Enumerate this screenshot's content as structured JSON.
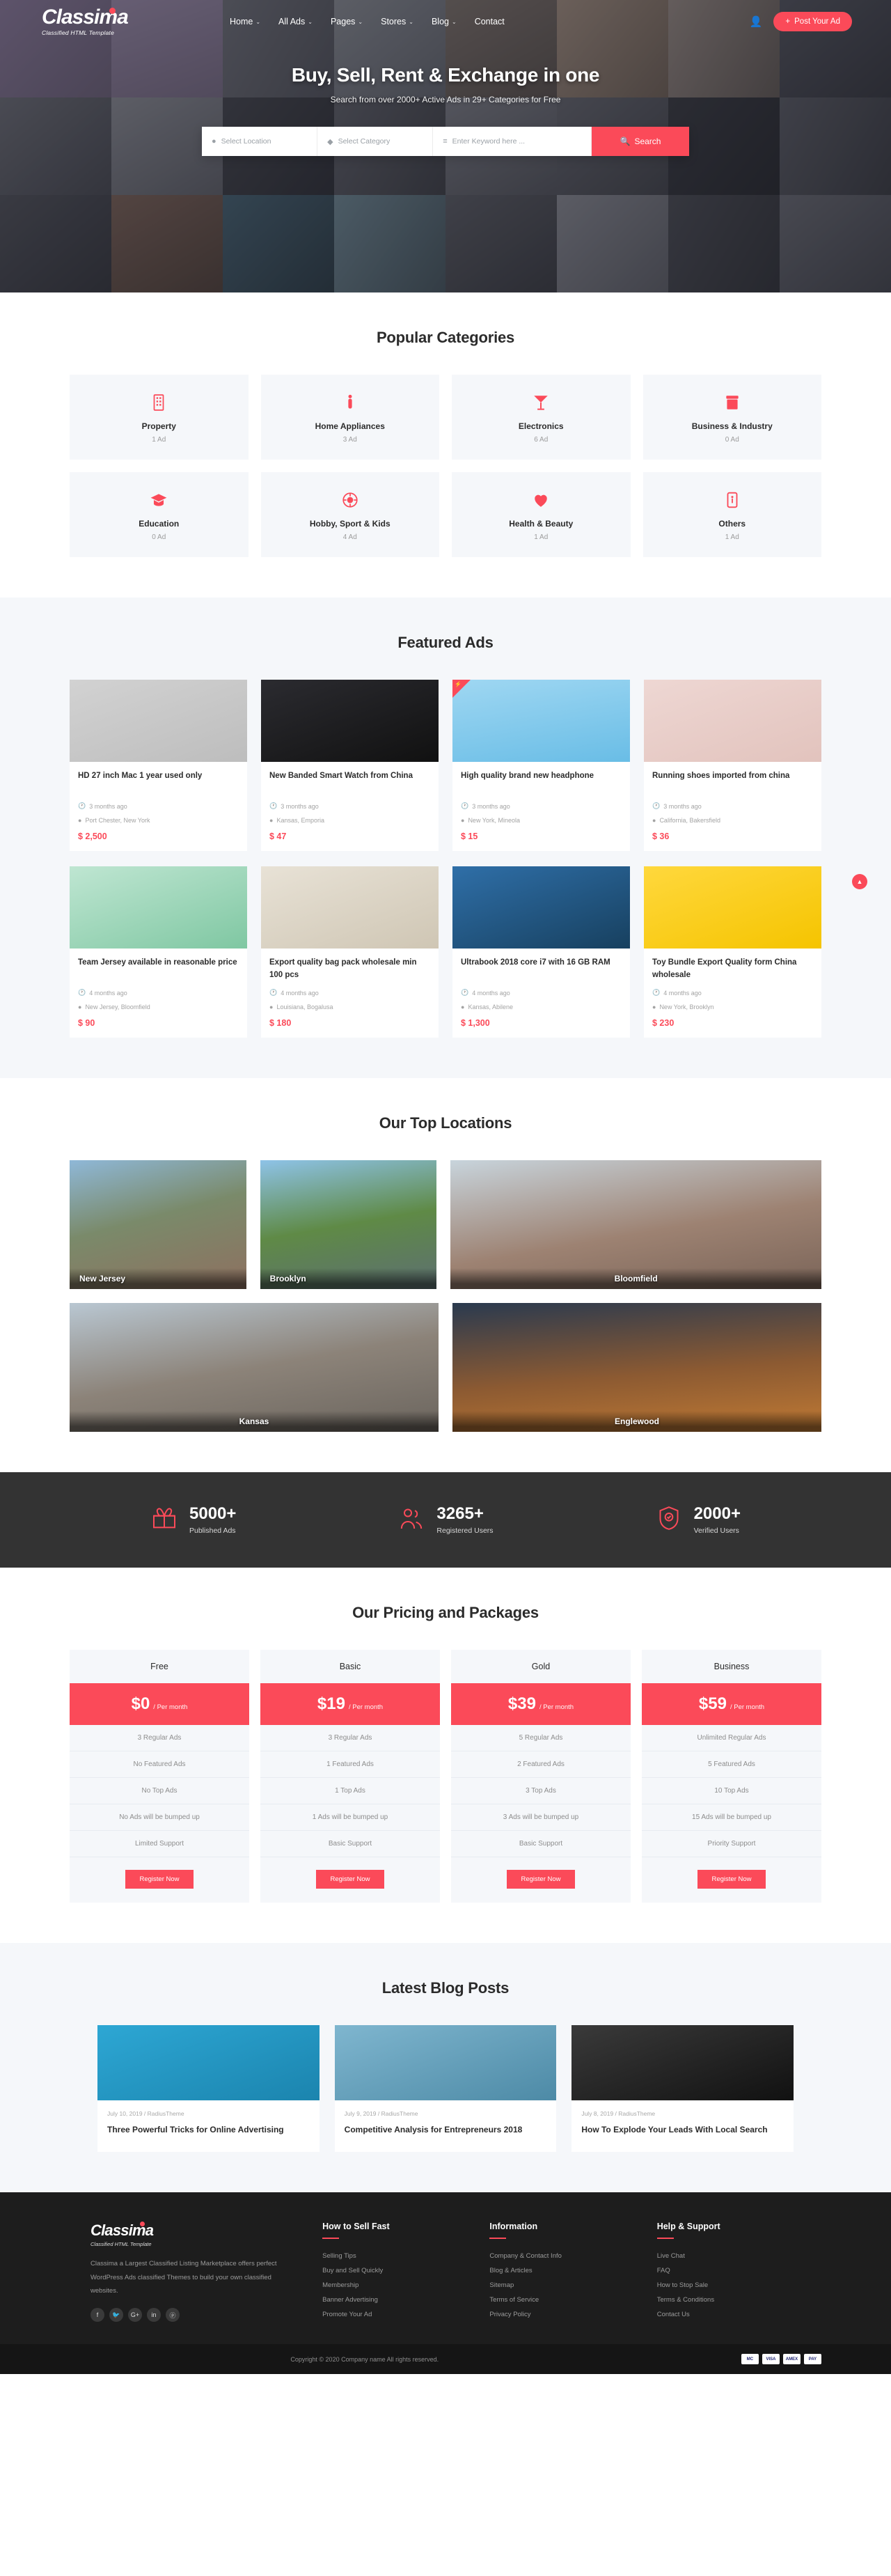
{
  "brand": {
    "name": "Classima",
    "tagline": "Classified HTML Template"
  },
  "nav": {
    "items": [
      {
        "label": "Home",
        "caret": "⌄"
      },
      {
        "label": "All Ads",
        "caret": "⌄"
      },
      {
        "label": "Pages",
        "caret": "⌄"
      },
      {
        "label": "Stores",
        "caret": "⌄"
      },
      {
        "label": "Blog",
        "caret": "⌄"
      },
      {
        "label": "Contact",
        "caret": ""
      }
    ],
    "user_icon": "user-icon",
    "post_ad_label": "Post Your Ad",
    "post_ad_plus": "+"
  },
  "hero": {
    "title": "Buy, Sell, Rent & Exchange in one",
    "subtitle": "Search from over 2000+ Active Ads in 29+ Categories for Free",
    "search": {
      "location_placeholder": "Select Location",
      "category_placeholder": "Select Category",
      "keyword_placeholder": "Enter Keyword here ...",
      "button_label": "Search"
    }
  },
  "categories": {
    "title": "Popular Categories",
    "items": [
      {
        "name": "Property",
        "count": "1 Ad",
        "icon": "building-icon"
      },
      {
        "name": "Home Appliances",
        "count": "3 Ad",
        "icon": "person-icon"
      },
      {
        "name": "Electronics",
        "count": "6 Ad",
        "icon": "cocktail-icon"
      },
      {
        "name": "Business & Industry",
        "count": "0 Ad",
        "icon": "briefcase-icon"
      },
      {
        "name": "Education",
        "count": "0 Ad",
        "icon": "graduation-cap-icon"
      },
      {
        "name": "Hobby, Sport & Kids",
        "count": "4 Ad",
        "icon": "ball-icon"
      },
      {
        "name": "Health & Beauty",
        "count": "1 Ad",
        "icon": "heart-icon"
      },
      {
        "name": "Others",
        "count": "1 Ad",
        "icon": "tag-icon"
      }
    ]
  },
  "featured": {
    "title": "Featured Ads",
    "ads": [
      {
        "title": "HD 27 inch Mac 1 year used only",
        "time": "3 months ago",
        "location": "Port Chester, New York",
        "price": "$ 2,500",
        "badge": ""
      },
      {
        "title": "New Banded Smart Watch from China",
        "time": "3 months ago",
        "location": "Kansas, Emporia",
        "price": "$ 47",
        "badge": ""
      },
      {
        "title": "High quality brand new headphone",
        "time": "3 months ago",
        "location": "New York, Mineola",
        "price": "$ 15",
        "badge": "⚡"
      },
      {
        "title": "Running shoes imported from china",
        "time": "3 months ago",
        "location": "California, Bakersfield",
        "price": "$ 36",
        "badge": ""
      },
      {
        "title": "Team Jersey available in reasonable price",
        "time": "4 months ago",
        "location": "New Jersey, Bloomfield",
        "price": "$ 90",
        "badge": ""
      },
      {
        "title": "Export quality bag pack wholesale min 100 pcs",
        "time": "4 months ago",
        "location": "Louisiana, Bogalusa",
        "price": "$ 180",
        "badge": ""
      },
      {
        "title": "Ultrabook 2018 core i7 with 16 GB RAM",
        "time": "4 months ago",
        "location": "Kansas, Abilene",
        "price": "$ 1,300",
        "badge": ""
      },
      {
        "title": "Toy Bundle Export Quality form China wholesale",
        "time": "4 months ago",
        "location": "New York, Brooklyn",
        "price": "$ 230",
        "badge": ""
      }
    ]
  },
  "locations": {
    "title": "Our Top Locations",
    "row1": [
      {
        "name": "New Jersey"
      },
      {
        "name": "Brooklyn"
      },
      {
        "name": "Bloomfield"
      }
    ],
    "row2": [
      {
        "name": "Kansas"
      },
      {
        "name": "Englewood"
      }
    ]
  },
  "counters": [
    {
      "number": "5000+",
      "label": "Published Ads",
      "icon": "gift-icon"
    },
    {
      "number": "3265+",
      "label": "Registered Users",
      "icon": "users-icon"
    },
    {
      "number": "2000+",
      "label": "Verified Users",
      "icon": "shield-check-icon"
    }
  ],
  "pricing": {
    "title": "Our Pricing and Packages",
    "per_month": "/ Per month",
    "cta_label": "Register Now",
    "plans": [
      {
        "name": "Free",
        "price": "$0",
        "features": [
          "3 Regular Ads",
          "No Featured Ads",
          "No Top Ads",
          "No Ads will be bumped up",
          "Limited Support"
        ]
      },
      {
        "name": "Basic",
        "price": "$19",
        "features": [
          "3 Regular Ads",
          "1 Featured Ads",
          "1 Top Ads",
          "1 Ads will be bumped up",
          "Basic Support"
        ]
      },
      {
        "name": "Gold",
        "price": "$39",
        "features": [
          "5 Regular Ads",
          "2 Featured Ads",
          "3 Top Ads",
          "3 Ads will be bumped up",
          "Basic Support"
        ]
      },
      {
        "name": "Business",
        "price": "$59",
        "features": [
          "Unlimited Regular Ads",
          "5 Featured Ads",
          "10 Top Ads",
          "15 Ads will be bumped up",
          "Priority Support"
        ]
      }
    ]
  },
  "blog": {
    "title": "Latest Blog Posts",
    "posts": [
      {
        "meta": "July 10, 2019 / RadiusTheme",
        "title": "Three Powerful Tricks for Online Advertising"
      },
      {
        "meta": "July 9, 2019 / RadiusTheme",
        "title": "Competitive Analysis for Entrepreneurs 2018"
      },
      {
        "meta": "July 8, 2019 / RadiusTheme",
        "title": "How To Explode Your Leads With Local Search"
      }
    ]
  },
  "footer": {
    "description": "Classima a Largest Classified Listing Marketplace offers perfect WordPress Ads classified Themes to build your own classified websites.",
    "social": [
      {
        "icon": "facebook-icon",
        "glyph": "f"
      },
      {
        "icon": "twitter-icon",
        "glyph": "🐦"
      },
      {
        "icon": "google-plus-icon",
        "glyph": "G+"
      },
      {
        "icon": "linkedin-icon",
        "glyph": "in"
      },
      {
        "icon": "pinterest-icon",
        "glyph": "ⓟ"
      }
    ],
    "columns": [
      {
        "heading": "How to Sell Fast",
        "links": [
          "Selling Tips",
          "Buy and Sell Quickly",
          "Membership",
          "Banner Advertising",
          "Promote Your Ad"
        ]
      },
      {
        "heading": "Information",
        "links": [
          "Company & Contact Info",
          "Blog & Articles",
          "Sitemap",
          "Terms of Service",
          "Privacy Policy"
        ]
      },
      {
        "heading": "Help & Support",
        "links": [
          "Live Chat",
          "FAQ",
          "How to Stop Sale",
          "Terms & Conditions",
          "Contact Us"
        ]
      }
    ],
    "copyright": "Copyright © 2020 Company name All rights reserved.",
    "payments": [
      "MC",
      "VISA",
      "AMEX",
      "PAY"
    ]
  },
  "scroll_top": "▲"
}
